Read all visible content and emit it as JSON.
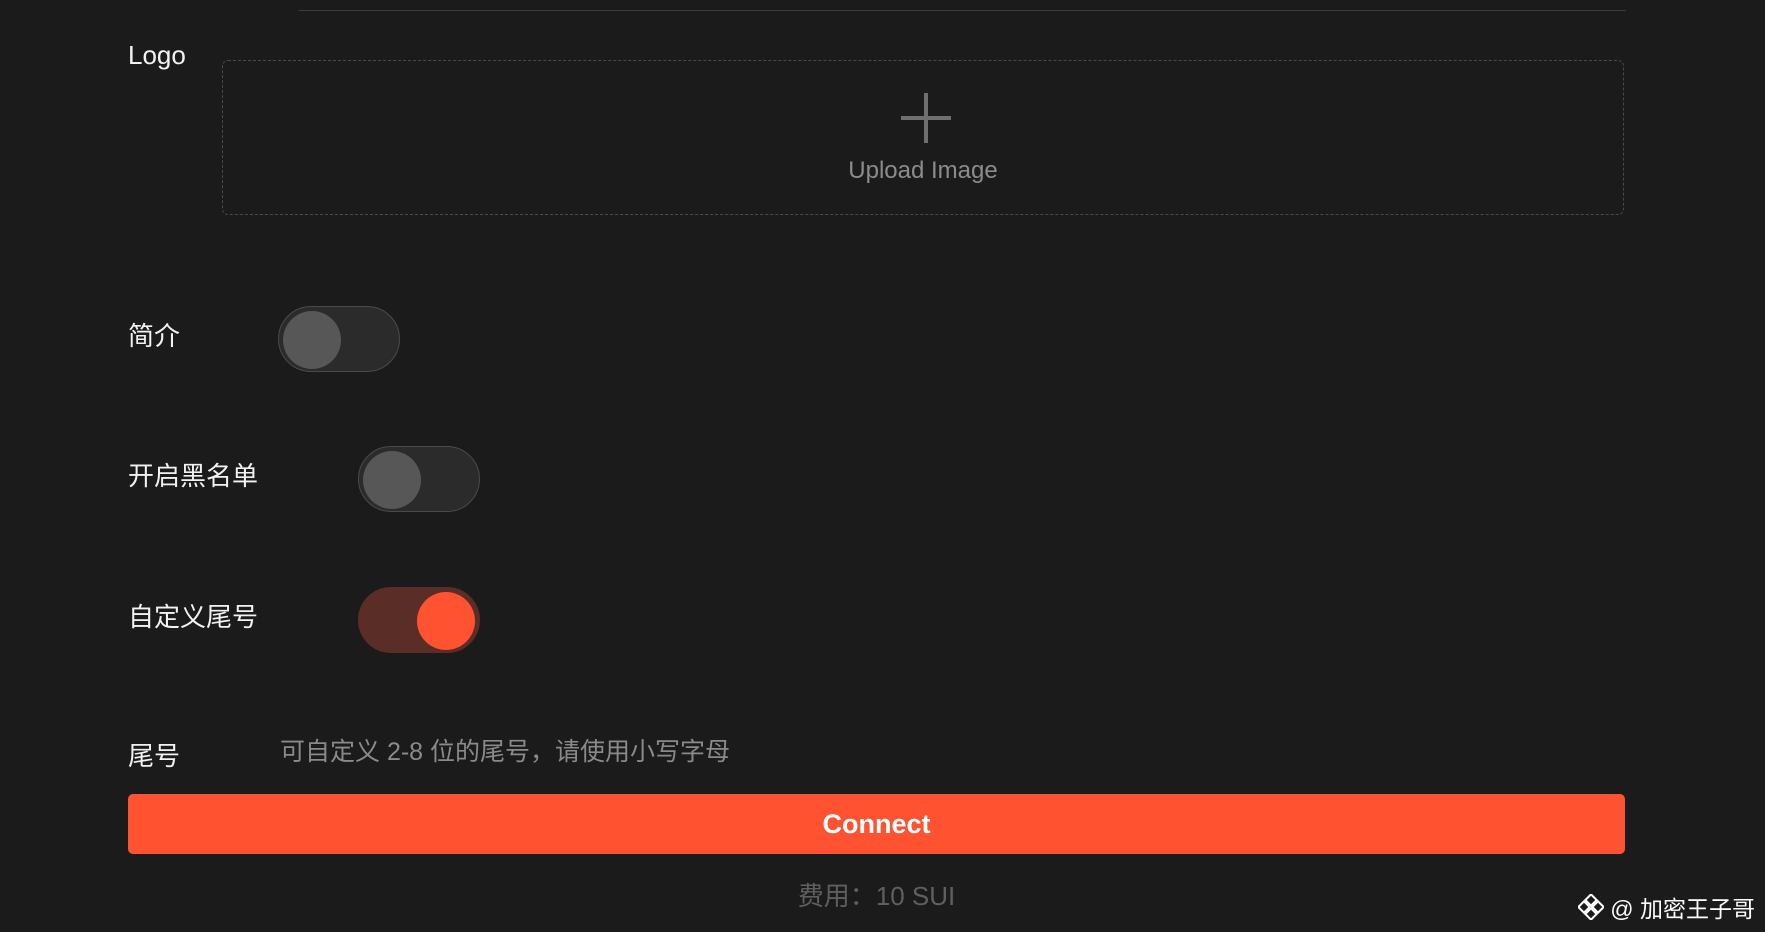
{
  "logo": {
    "label": "Logo",
    "upload_text": "Upload Image",
    "icon": "plus-icon"
  },
  "toggles": {
    "intro": {
      "label": "简介",
      "on": false
    },
    "blacklist": {
      "label": "开启黑名单",
      "on": false
    },
    "custom_suffix": {
      "label": "自定义尾号",
      "on": true
    }
  },
  "suffix": {
    "label": "尾号",
    "value": "",
    "placeholder": "可自定义 2-8 位的尾号，请使用小写字母"
  },
  "connect_button": {
    "label": "Connect"
  },
  "fee": {
    "text": "费用：10 SUI"
  },
  "watermark": {
    "text": "@ 加密王子哥",
    "icon": "binance-logo-icon"
  },
  "colors": {
    "background": "#1b1b1b",
    "accent": "#ff5230",
    "toggle_on_track": "#5a2e26",
    "toggle_off_track": "#2b2b2b",
    "toggle_off_knob": "#575757"
  }
}
